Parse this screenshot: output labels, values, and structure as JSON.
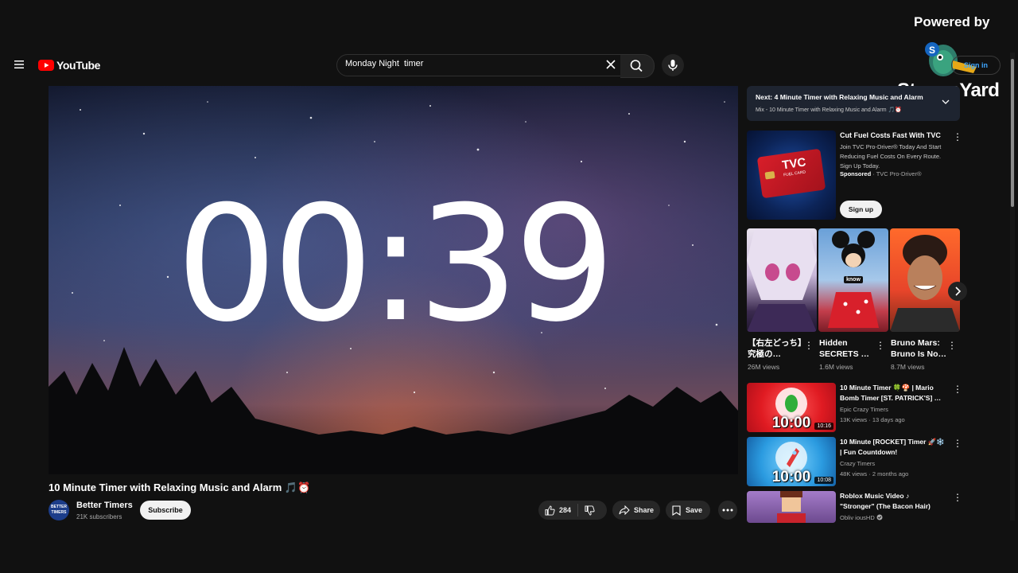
{
  "overlay": {
    "powered_by": "Powered by",
    "brand": "StreamYard"
  },
  "header": {
    "logo_text": "YouTube",
    "search_value": "Monday Night  timer",
    "sign_in": "Sign in"
  },
  "video": {
    "timer_display": "00:39",
    "title": "10 Minute Timer with Relaxing Music and Alarm 🎵⏰"
  },
  "channel": {
    "avatar_text": "BETTER TIMERS",
    "name": "Better Timers",
    "subscribers": "21K subscribers",
    "subscribe_label": "Subscribe"
  },
  "actions": {
    "like_count": "284",
    "share_label": "Share",
    "save_label": "Save"
  },
  "sidebar": {
    "next_up": "Next: 4 Minute Timer with Relaxing Music and Alarm",
    "mix_info": "Mix - 10 Minute Timer with Relaxing Music and Alarm 🎵⏰",
    "ad": {
      "thumb_text": "TVC",
      "card_text": "FUEL CARD",
      "title": "Cut Fuel Costs Fast With TVC",
      "description": "Join TVC Pro-Driver® Today And Start Reducing Fuel Costs On Every Route. Sign Up Today.",
      "sponsored": "Sponsored",
      "sponsor_name": "· TVC Pro-Driver®",
      "cta": "Sign up"
    },
    "shorts": [
      {
        "title": "【右左どっち】究極の…",
        "views": "26M views",
        "badge": ""
      },
      {
        "title": "Hidden SECRETS …",
        "views": "1.6M views",
        "badge": "know"
      },
      {
        "title": "Bruno Mars: Bruno Is No…",
        "views": "8.7M views",
        "badge": ""
      }
    ],
    "videos": [
      {
        "title": "10 Minute Timer 🍀🍄 | Mario Bomb Timer [ST. PATRICK'S] …",
        "channel": "Epic Crazy Timers",
        "meta": "13K views · 13 days ago",
        "duration": "10:16",
        "thumb_time": "10:00"
      },
      {
        "title": "10 Minute [ROCKET] Timer 🚀❄️ | Fun Countdown!",
        "channel": "Crazy Timers",
        "meta": "48K views · 2 months ago",
        "duration": "10:08",
        "thumb_time": "10:00"
      },
      {
        "title": "Roblox Music Video ♪ \"Stronger\" (The Bacon Hair)",
        "channel": "Obliv iousHD",
        "meta": "",
        "duration": "",
        "thumb_time": ""
      }
    ]
  },
  "colors": {
    "background": "#111111",
    "brand_red": "#ff0000",
    "link_blue": "#3ea6ff"
  }
}
